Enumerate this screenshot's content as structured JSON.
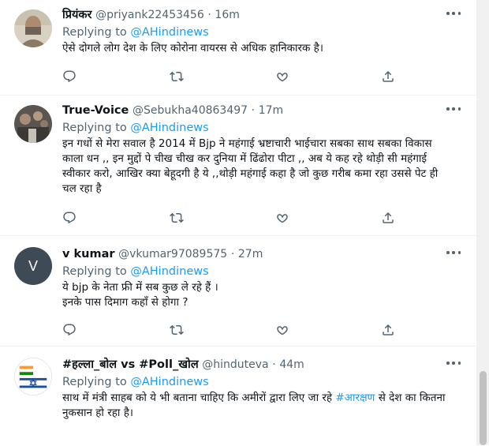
{
  "tweets": [
    {
      "name": "प्रियंकर",
      "handle": "@priyank22453456",
      "sep": "·",
      "time": "16m",
      "replying_prefix": "Replying to ",
      "replying_to": "@AHindinews",
      "text_before": "ऐसे दोगले लोग देश के लिए कोरोना वायरस से अधिक हानिकारक है।",
      "hashtag": "",
      "text_after": "",
      "avatar_icon": "user-photo-icon",
      "avatar_colors": [
        "#d9d2c2",
        "#8a7a66"
      ]
    },
    {
      "name": "True-Voice",
      "handle": "@Sebukha40863497",
      "sep": "·",
      "time": "17m",
      "replying_prefix": "Replying to ",
      "replying_to": "@AHindinews",
      "text_before": "इन गधों से मेरा सवाल है 2014 में Bjp ने महंगाई भ्रष्टाचारी  भाईचारा सबका साथ सबका विकास काला धन ,, इन मुद्दों पे चीख चीख कर दुनिया में ढिंढोरा पीटा ,, अब ये कह रहे थोड़ी सी महंगाई स्वीकार करो, आखिर क्या बेहूदगी है ये ,,थोड़ी महंगाई कहा है जो कुछ गरीब कमा रहा उससे पेट ही चल रहा है",
      "hashtag": "",
      "text_after": "",
      "avatar_icon": "group-photo-icon",
      "avatar_colors": [
        "#4a4a4a",
        "#9c8b7a"
      ]
    },
    {
      "name": "v kumar",
      "handle": "@vkumar97089575",
      "sep": "·",
      "time": "27m",
      "replying_prefix": "Replying to ",
      "replying_to": "@AHindinews",
      "text_before": "ये bjp के नेता फ्री में सब कुछ ले रहे हैं ।\nइनके पास दिमाग कहाँ से होगा ?",
      "hashtag": "",
      "text_after": "",
      "avatar_letter": "V",
      "avatar_icon": "letter-avatar-icon",
      "avatar_colors": [
        "#3e4b56",
        "#ffffff"
      ]
    },
    {
      "name": "#हल्ला_बोल vs #Poll_खोल",
      "handle": "@hinduteva",
      "sep": "·",
      "time": "44m",
      "replying_prefix": "Replying to ",
      "replying_to": "@AHindinews",
      "text_before": "साथ में मंत्री साहब को ये भी बताना चाहिए कि अमीरों द्वारा लिए जा रहे ",
      "hashtag": "#आरक्षण",
      "text_after": " से देश का कितना नुकसान हो रहा है।",
      "avatar_icon": "flag-avatar-icon",
      "avatar_colors": [
        "#ff9933",
        "#138808",
        "#1a4fa0"
      ]
    }
  ],
  "actions": [
    "reply-icon",
    "retweet-icon",
    "like-icon",
    "share-icon"
  ],
  "colors": {
    "accent": "#1d9bf0",
    "muted": "#536471",
    "text": "#0f1419",
    "divider": "#eff3f4"
  }
}
